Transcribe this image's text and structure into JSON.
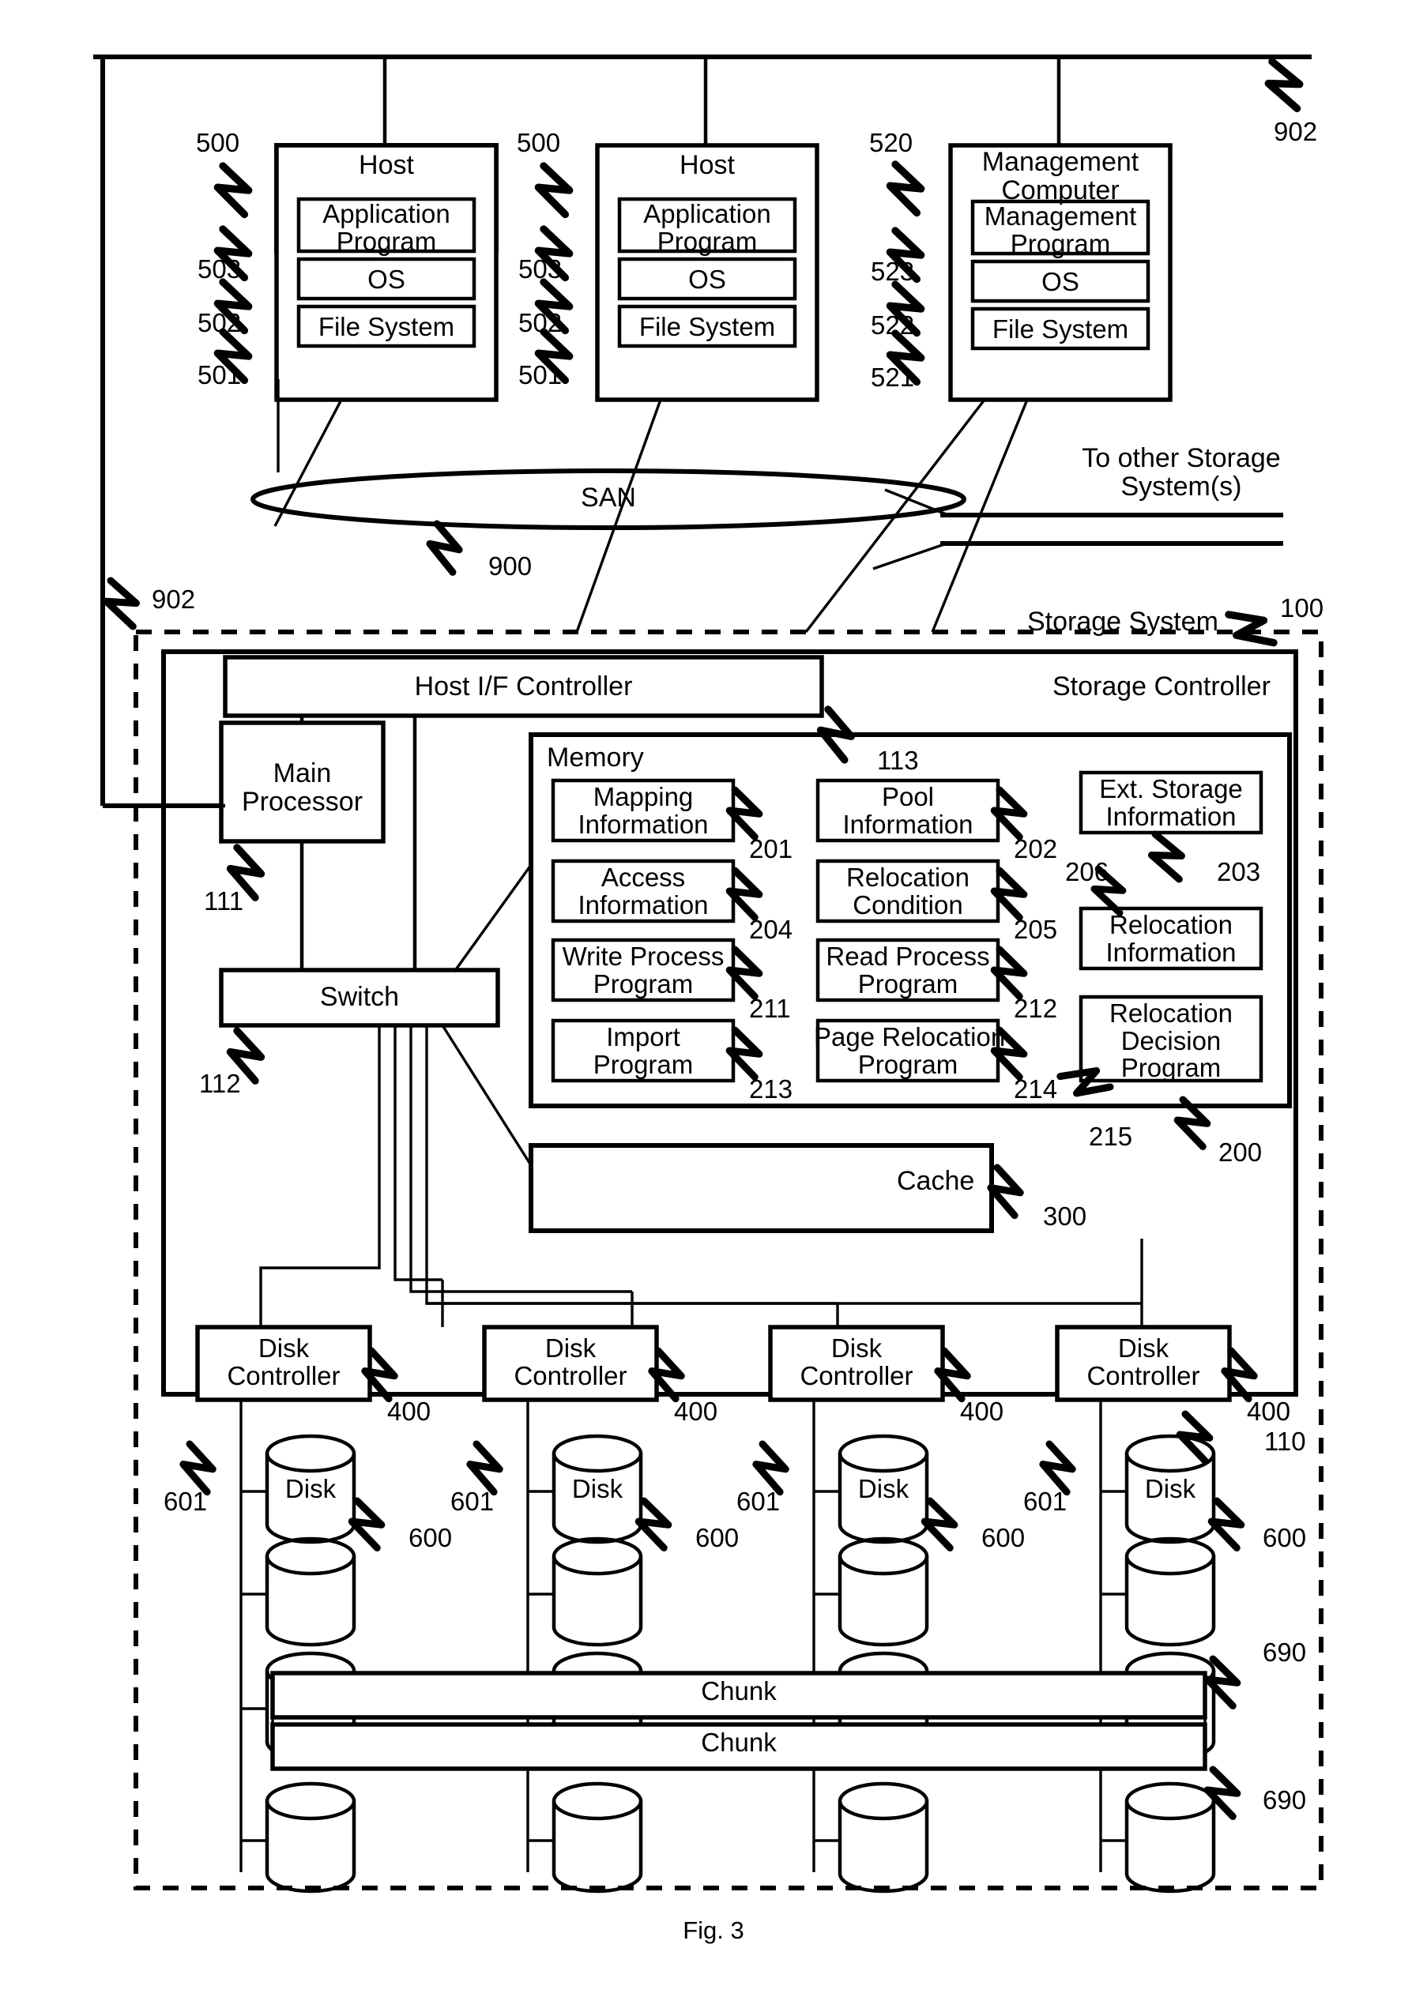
{
  "figure": {
    "caption": "Fig. 3"
  },
  "hosts": [
    {
      "title": "Host",
      "ref": "500",
      "rows": [
        {
          "label": "Application\nProgram",
          "ref": "503"
        },
        {
          "label": "OS",
          "ref": "502"
        },
        {
          "label": "File System",
          "ref": "501"
        }
      ]
    },
    {
      "title": "Host",
      "ref": "500",
      "rows": [
        {
          "label": "Application\nProgram",
          "ref": "503"
        },
        {
          "label": "OS",
          "ref": "502"
        },
        {
          "label": "File System",
          "ref": "501"
        }
      ]
    }
  ],
  "management_computer": {
    "title": "Management\nComputer",
    "ref": "520",
    "rows": [
      {
        "label": "Management\nProgram",
        "ref": "523"
      },
      {
        "label": "OS",
        "ref": "522"
      },
      {
        "label": "File System",
        "ref": "521"
      }
    ]
  },
  "network": {
    "san_label": "SAN",
    "san_ref": "900",
    "link_ref_top": "902",
    "link_ref_left": "902",
    "to_other_storage": "To other Storage\nSystem(s)"
  },
  "storage_system": {
    "label": "Storage System",
    "ref": "100",
    "controller_label": "Storage Controller",
    "host_if_controller": {
      "label": "Host I/F Controller",
      "ref": "113"
    },
    "main_processor": {
      "label": "Main\nProcessor",
      "ref": "111"
    },
    "switch": {
      "label": "Switch",
      "ref": "112"
    },
    "cache": {
      "label": "Cache",
      "ref": "300"
    },
    "disk_array_ref": "110"
  },
  "memory": {
    "title": "Memory",
    "ref": "200",
    "items": [
      {
        "label": "Mapping\nInformation",
        "ref": "201",
        "col": 0,
        "row": 0
      },
      {
        "label": "Access\nInformation",
        "ref": "204",
        "col": 0,
        "row": 1
      },
      {
        "label": "Write Process\nProgram",
        "ref": "211",
        "col": 0,
        "row": 2
      },
      {
        "label": "Import\nProgram",
        "ref": "213",
        "col": 0,
        "row": 3
      },
      {
        "label": "Pool\nInformation",
        "ref": "202",
        "col": 1,
        "row": 0
      },
      {
        "label": "Relocation\nCondition",
        "ref": "205",
        "col": 1,
        "row": 1
      },
      {
        "label": "Read Process\nProgram",
        "ref": "212",
        "col": 1,
        "row": 2
      },
      {
        "label": "Page Relocation\nProgram",
        "ref": "214",
        "col": 1,
        "row": 3
      },
      {
        "label": "Ext. Storage\nInformation",
        "ref": "203",
        "col": 2,
        "row": 0
      },
      {
        "label": "Relocation\nInformation",
        "ref": "206",
        "col": 2,
        "row": 1
      },
      {
        "label": "Relocation\nDecision\nProgram",
        "ref": "215",
        "col": 2,
        "row": 2
      }
    ]
  },
  "disk_controllers": [
    {
      "label": "Disk\nController",
      "ref": "400"
    },
    {
      "label": "Disk\nController",
      "ref": "400"
    },
    {
      "label": "Disk\nController",
      "ref": "400"
    },
    {
      "label": "Disk\nController",
      "ref": "400"
    }
  ],
  "disk_columns": [
    {
      "disk_label": "Disk",
      "disk_ref": "600",
      "bus_ref": "601"
    },
    {
      "disk_label": "Disk",
      "disk_ref": "600",
      "bus_ref": "601"
    },
    {
      "disk_label": "Disk",
      "disk_ref": "600",
      "bus_ref": "601"
    },
    {
      "disk_label": "Disk",
      "disk_ref": "600",
      "bus_ref": "601"
    }
  ],
  "chunks": [
    {
      "label": "Chunk",
      "ref": "690"
    },
    {
      "label": "Chunk",
      "ref": "690"
    }
  ]
}
